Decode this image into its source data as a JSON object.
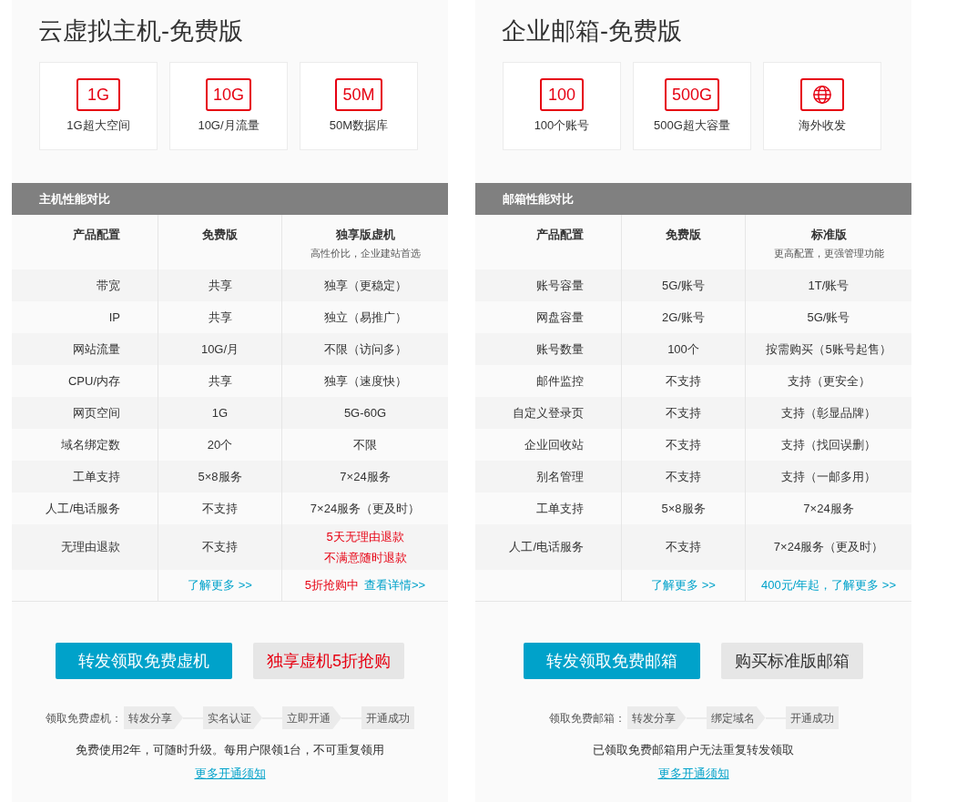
{
  "panels": [
    {
      "title": "云虚拟主机-免费版",
      "features": [
        {
          "kind": "text",
          "badge": "1G",
          "label": "1G超大空间"
        },
        {
          "kind": "text",
          "badge": "10G",
          "label": "10G/月流量"
        },
        {
          "kind": "text",
          "badge": "50M",
          "label": "50M数据库"
        }
      ],
      "table": {
        "title": "主机性能对比",
        "columns": [
          {
            "name": "产品配置"
          },
          {
            "name": "免费版"
          },
          {
            "name": "独享版虚机",
            "subtitle": "高性价比，企业建站首选"
          }
        ],
        "rows": [
          {
            "cells": [
              {
                "lines": [
                  "带宽"
                ],
                "highlight": false
              },
              {
                "lines": [
                  "共享"
                ],
                "highlight": false
              },
              {
                "lines": [
                  "独享（更稳定）"
                ],
                "highlight": false
              }
            ]
          },
          {
            "cells": [
              {
                "lines": [
                  "IP"
                ],
                "highlight": false
              },
              {
                "lines": [
                  "共享"
                ],
                "highlight": false
              },
              {
                "lines": [
                  "独立（易推广）"
                ],
                "highlight": false
              }
            ]
          },
          {
            "cells": [
              {
                "lines": [
                  "网站流量"
                ],
                "highlight": false
              },
              {
                "lines": [
                  "10G/月"
                ],
                "highlight": false
              },
              {
                "lines": [
                  "不限（访问多）"
                ],
                "highlight": false
              }
            ]
          },
          {
            "cells": [
              {
                "lines": [
                  "CPU/内存"
                ],
                "highlight": false
              },
              {
                "lines": [
                  "共享"
                ],
                "highlight": false
              },
              {
                "lines": [
                  "独享（速度快）"
                ],
                "highlight": false
              }
            ]
          },
          {
            "cells": [
              {
                "lines": [
                  "网页空间"
                ],
                "highlight": false
              },
              {
                "lines": [
                  "1G"
                ],
                "highlight": false
              },
              {
                "lines": [
                  "5G-60G"
                ],
                "highlight": false
              }
            ]
          },
          {
            "cells": [
              {
                "lines": [
                  "域名绑定数"
                ],
                "highlight": false
              },
              {
                "lines": [
                  "20个"
                ],
                "highlight": false
              },
              {
                "lines": [
                  "不限"
                ],
                "highlight": false
              }
            ]
          },
          {
            "cells": [
              {
                "lines": [
                  "工单支持"
                ],
                "highlight": false
              },
              {
                "lines": [
                  "5×8服务"
                ],
                "highlight": false
              },
              {
                "lines": [
                  "7×24服务"
                ],
                "highlight": false
              }
            ]
          },
          {
            "cells": [
              {
                "lines": [
                  "人工/电话服务"
                ],
                "highlight": false
              },
              {
                "lines": [
                  "不支持"
                ],
                "highlight": false
              },
              {
                "lines": [
                  "7×24服务（更及时）"
                ],
                "highlight": false
              }
            ]
          },
          {
            "cells": [
              {
                "lines": [
                  "无理由退款"
                ],
                "highlight": false
              },
              {
                "lines": [
                  "不支持"
                ],
                "highlight": false
              },
              {
                "lines": [
                  "5天无理由退款",
                  "不满意随时退款"
                ],
                "highlight": true
              }
            ]
          }
        ],
        "links": [
          [
            {
              "kind": "link",
              "text": "了解更多 >>"
            }
          ],
          [
            {
              "kind": "promo",
              "text": "5折抢购中"
            },
            {
              "kind": "link",
              "text": "查看详情>>"
            }
          ]
        ]
      },
      "actions": [
        {
          "kind": "primary",
          "label": "转发领取免费虚机"
        },
        {
          "kind": "promo",
          "label": "独享虚机5折抢购"
        }
      ],
      "steps": {
        "label": "领取免费虚机：",
        "items": [
          "转发分享",
          "实名认证",
          "立即开通",
          "开通成功"
        ]
      },
      "note": "免费使用2年，可随时升级。每用户限领1台，不可重复领用",
      "notice_link": "更多开通须知"
    },
    {
      "title": "企业邮箱-免费版",
      "features": [
        {
          "kind": "text",
          "badge": "100",
          "label": "100个账号"
        },
        {
          "kind": "text",
          "badge": "500G",
          "label": "500G超大容量"
        },
        {
          "kind": "globe",
          "label": "海外收发"
        }
      ],
      "table": {
        "title": "邮箱性能对比",
        "columns": [
          {
            "name": "产品配置"
          },
          {
            "name": "免费版"
          },
          {
            "name": "标准版",
            "subtitle": "更高配置，更强管理功能"
          }
        ],
        "rows": [
          {
            "cells": [
              {
                "lines": [
                  "账号容量"
                ],
                "highlight": false
              },
              {
                "lines": [
                  "5G/账号"
                ],
                "highlight": false
              },
              {
                "lines": [
                  "1T/账号"
                ],
                "highlight": false
              }
            ]
          },
          {
            "cells": [
              {
                "lines": [
                  "网盘容量"
                ],
                "highlight": false
              },
              {
                "lines": [
                  "2G/账号"
                ],
                "highlight": false
              },
              {
                "lines": [
                  "5G/账号"
                ],
                "highlight": false
              }
            ]
          },
          {
            "cells": [
              {
                "lines": [
                  "账号数量"
                ],
                "highlight": false
              },
              {
                "lines": [
                  "100个"
                ],
                "highlight": false
              },
              {
                "lines": [
                  "按需购买（5账号起售）"
                ],
                "highlight": false
              }
            ]
          },
          {
            "cells": [
              {
                "lines": [
                  "邮件监控"
                ],
                "highlight": false
              },
              {
                "lines": [
                  "不支持"
                ],
                "highlight": false
              },
              {
                "lines": [
                  "支持（更安全）"
                ],
                "highlight": false
              }
            ]
          },
          {
            "cells": [
              {
                "lines": [
                  "自定义登录页"
                ],
                "highlight": false
              },
              {
                "lines": [
                  "不支持"
                ],
                "highlight": false
              },
              {
                "lines": [
                  "支持（彰显品牌）"
                ],
                "highlight": false
              }
            ]
          },
          {
            "cells": [
              {
                "lines": [
                  "企业回收站"
                ],
                "highlight": false
              },
              {
                "lines": [
                  "不支持"
                ],
                "highlight": false
              },
              {
                "lines": [
                  "支持（找回误删）"
                ],
                "highlight": false
              }
            ]
          },
          {
            "cells": [
              {
                "lines": [
                  "别名管理"
                ],
                "highlight": false
              },
              {
                "lines": [
                  "不支持"
                ],
                "highlight": false
              },
              {
                "lines": [
                  "支持（一邮多用）"
                ],
                "highlight": false
              }
            ]
          },
          {
            "cells": [
              {
                "lines": [
                  "工单支持"
                ],
                "highlight": false
              },
              {
                "lines": [
                  "5×8服务"
                ],
                "highlight": false
              },
              {
                "lines": [
                  "7×24服务"
                ],
                "highlight": false
              }
            ]
          },
          {
            "cells": [
              {
                "lines": [
                  "人工/电话服务"
                ],
                "highlight": false
              },
              {
                "lines": [
                  "不支持"
                ],
                "highlight": false
              },
              {
                "lines": [
                  "7×24服务（更及时）"
                ],
                "highlight": false
              }
            ]
          }
        ],
        "links": [
          [
            {
              "kind": "link",
              "text": "了解更多 >>"
            }
          ],
          [
            {
              "kind": "link",
              "text": "400元/年起，了解更多 >>"
            }
          ]
        ]
      },
      "actions": [
        {
          "kind": "primary",
          "label": "转发领取免费邮箱"
        },
        {
          "kind": "secondary",
          "label": "购买标准版邮箱"
        }
      ],
      "steps": {
        "label": "领取免费邮箱：",
        "items": [
          "转发分享",
          "绑定域名",
          "开通成功"
        ]
      },
      "note": "已领取免费邮箱用户无法重复转发领取",
      "notice_link": "更多开通须知"
    }
  ]
}
